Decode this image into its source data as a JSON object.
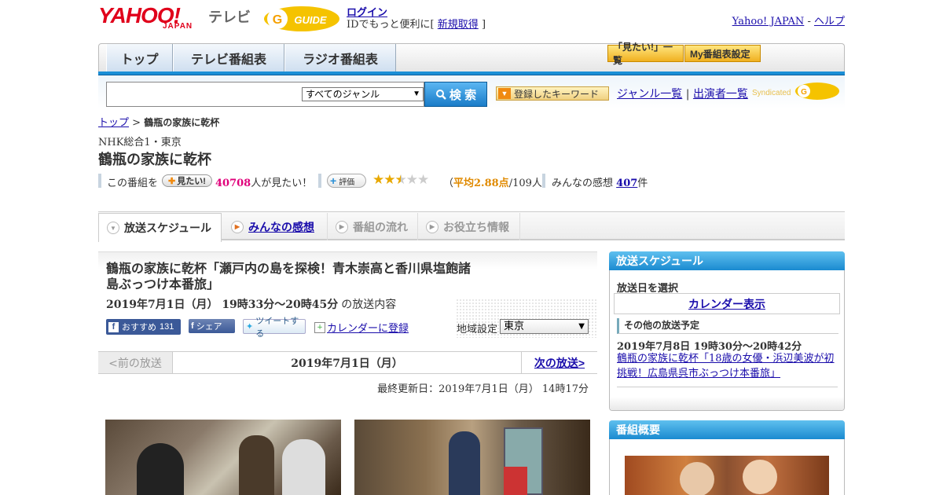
{
  "header": {
    "logo_yahoo": "YAHOO!",
    "logo_japan": "JAPAN",
    "logo_tv": "テレビ",
    "login_label": "ログイン",
    "login_prompt_pre": "IDでもっと便利に[",
    "register_label": "新規取得",
    "login_prompt_post": "]",
    "yahoo_japan_link": "Yahoo! JAPAN",
    "dash": "-",
    "help_link": "ヘルプ"
  },
  "nav": {
    "tabs": [
      {
        "label": "トップ"
      },
      {
        "label": "テレビ番組表"
      },
      {
        "label": "ラジオ番組表"
      }
    ],
    "mitai_list": "「見たい!」一覧",
    "my_schedule": "My番組表設定"
  },
  "search": {
    "input_value": "",
    "genre_selected": "すべてのジャンル",
    "search_button": "検 索",
    "keyword_button": "登録したキーワード",
    "genre_list_link": "ジャンル一覧",
    "divider": "|",
    "performer_list_link": "出演者一覧",
    "syndicated": "Syndicated"
  },
  "breadcrumb": {
    "home": "トップ",
    "separator": ">",
    "current": "鶴瓶の家族に乾杯"
  },
  "program": {
    "channel": "NHK総合1・東京",
    "title": "鶴瓶の家族に乾杯",
    "mitai_prefix": "この番組を",
    "mitai_button": "見たい!",
    "mitai_count": "40708",
    "mitai_suffix": "人が見たい！",
    "hyoka_button": "評価",
    "rating_value": 2.88,
    "avg_prefix": "（",
    "avg_label": "平均2.88点",
    "avg_count": "/109人）",
    "impress_label": "みんなの感想",
    "impress_count": "407",
    "impress_unit": "件"
  },
  "tabs": [
    {
      "label": "放送スケジュール",
      "state": "active"
    },
    {
      "label": "みんなの感想",
      "state": "link"
    },
    {
      "label": "番組の流れ",
      "state": "disabled"
    },
    {
      "label": "お役立ち情報",
      "state": "disabled"
    }
  ],
  "episode": {
    "title": "鶴瓶の家族に乾杯「瀬戸内の島を探検！青木崇高と香川県塩飽諸島ぶっつけ本番旅」",
    "datetime": "2019年7月1日（月） 19時33分～20時45分",
    "datetime_suffix": "の放送内容",
    "fb_recommend": "おすすめ",
    "fb_count": "131",
    "fb_share": "シェア",
    "tweet": "ツイートする",
    "calendar_register": "カレンダーに登録",
    "region_label": "地域設定",
    "region_selected": "東京",
    "prev_label": "<前の放送",
    "current_date": "2019年7月1日（月）",
    "next_label": "次の放送>",
    "updated": "最終更新日：2019年7月1日（月） 14時17分"
  },
  "sidebar": {
    "schedule_heading": "放送スケジュール",
    "select_date": "放送日を選択",
    "calendar_link": "カレンダー表示",
    "other_heading": "その他の放送予定",
    "other_date": "2019年7月8日 19時30分～20時42分",
    "other_title": "鶴瓶の家族に乾杯「18歳の女優・浜辺美波が初挑戦！広島県呉市ぶっつけ本番旅」",
    "overview_heading": "番組概要"
  },
  "colors": {
    "accent_blue": "#1a8fd6",
    "link": "#1a0dab",
    "count_pink": "#e0007a",
    "star_gold": "#e8a800"
  }
}
